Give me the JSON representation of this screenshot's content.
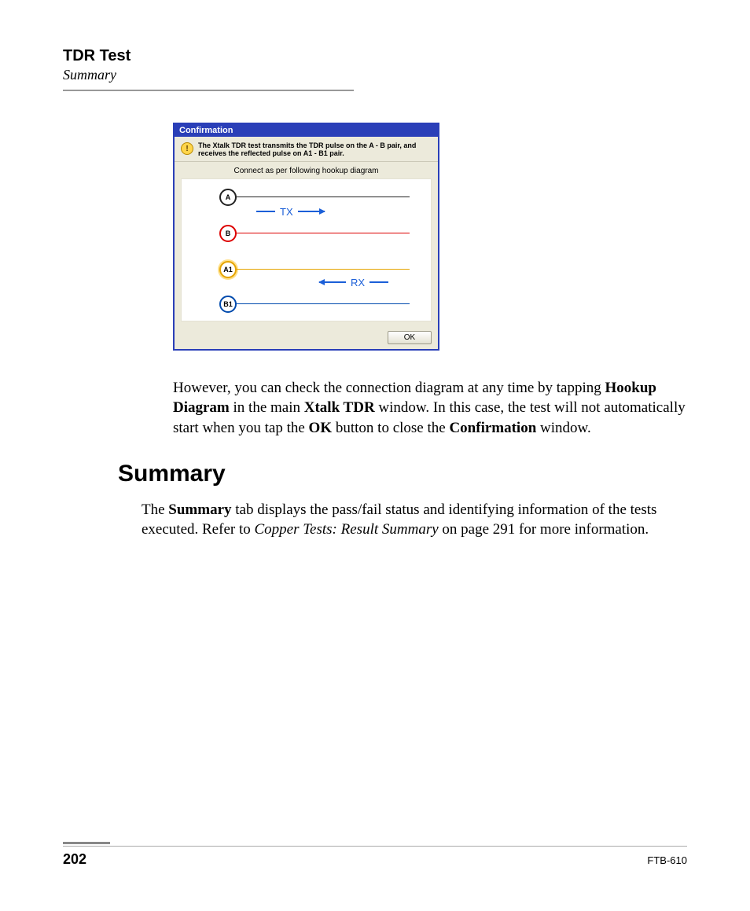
{
  "header": {
    "title": "TDR Test",
    "subtitle": "Summary"
  },
  "dialog": {
    "title": "Confirmation",
    "info_text": "The Xtalk TDR test transmits the TDR pulse on the A - B pair, and receives the reflected pulse on A1 - B1 pair.",
    "instruction": "Connect as per following hookup diagram",
    "nodes": {
      "A": "A",
      "B": "B",
      "A1": "A1",
      "B1": "B1"
    },
    "labels": {
      "tx": "TX",
      "rx": "RX"
    },
    "ok_label": "OK"
  },
  "para1": {
    "pre": "However, you can check the connection diagram at any time by tapping ",
    "b1": "Hookup Diagram",
    "mid1": " in the main ",
    "b2": "Xtalk TDR",
    "mid2": " window. In this case, the test will not automatically start when you tap the ",
    "b3": "OK",
    "mid3": " button to close the ",
    "b4": "Confirmation",
    "post": " window."
  },
  "section_heading": "Summary",
  "para2": {
    "pre": "The ",
    "b1": "Summary",
    "mid1": " tab displays the pass/fail status and identifying information of the tests executed. Refer to ",
    "i1": "Copper Tests: Result Summary",
    "post": " on page 291 for more information."
  },
  "footer": {
    "page": "202",
    "model": "FTB-610"
  }
}
